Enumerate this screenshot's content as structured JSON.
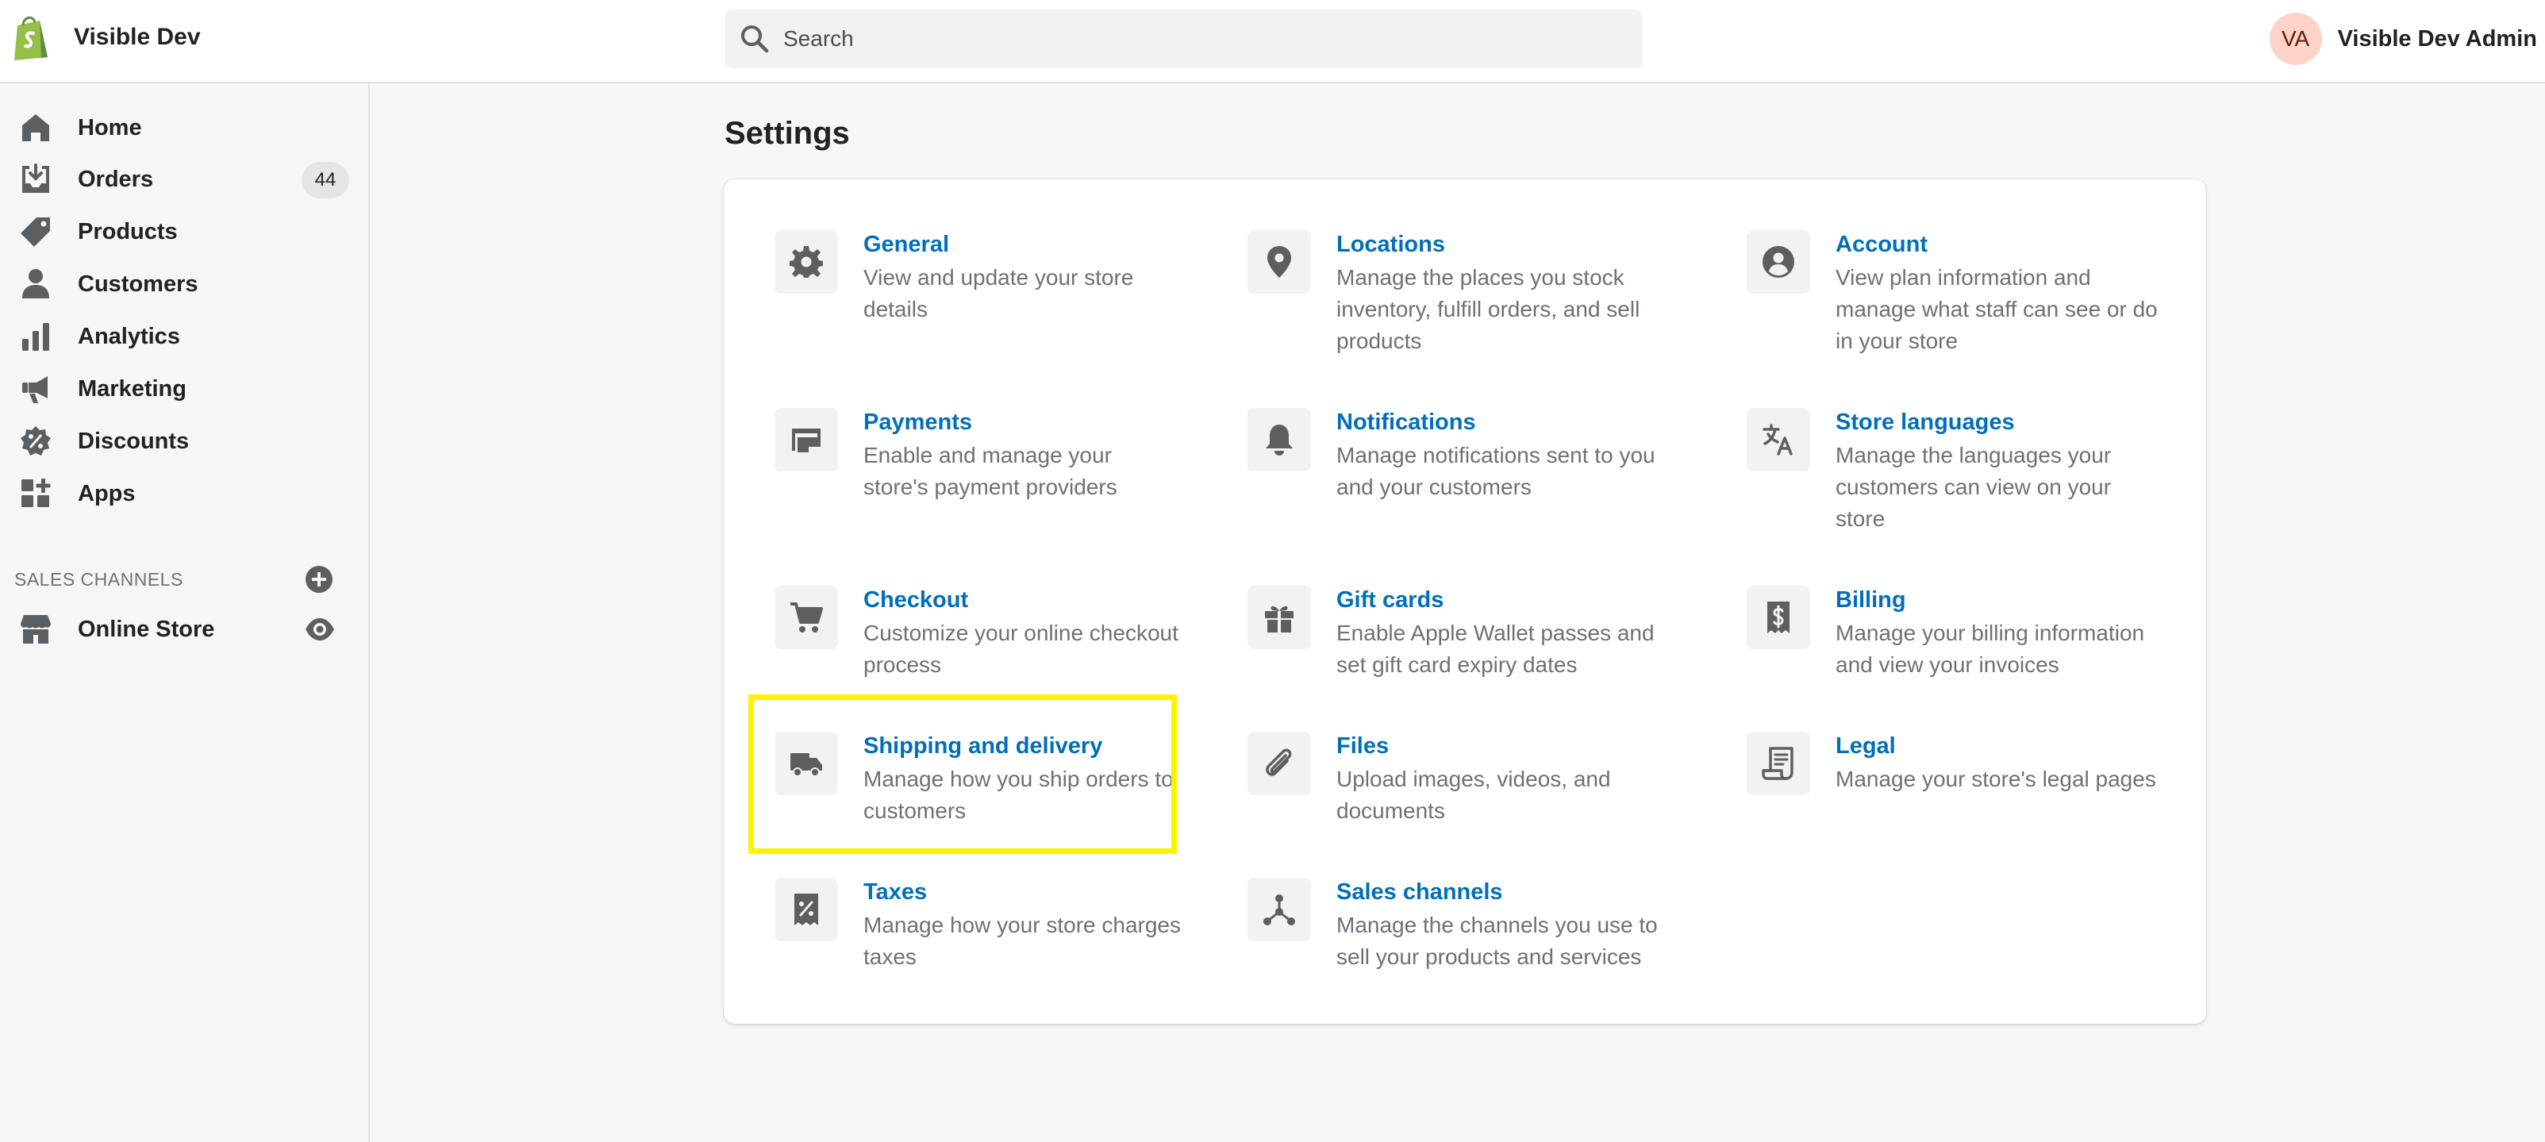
{
  "header": {
    "store_name": "Visible Dev",
    "search_placeholder": "Search",
    "user_initials": "VA",
    "user_name": "Visible Dev Admin"
  },
  "sidebar": {
    "items": [
      {
        "label": "Home",
        "icon": "home-icon"
      },
      {
        "label": "Orders",
        "icon": "orders-icon",
        "badge": "44"
      },
      {
        "label": "Products",
        "icon": "tag-icon"
      },
      {
        "label": "Customers",
        "icon": "person-icon"
      },
      {
        "label": "Analytics",
        "icon": "bar-chart-icon"
      },
      {
        "label": "Marketing",
        "icon": "megaphone-icon"
      },
      {
        "label": "Discounts",
        "icon": "discount-icon"
      },
      {
        "label": "Apps",
        "icon": "apps-icon"
      }
    ],
    "channels_heading": "SALES CHANNELS",
    "channels": [
      {
        "label": "Online Store",
        "icon": "store-icon"
      }
    ]
  },
  "main": {
    "title": "Settings",
    "settings": [
      {
        "title": "General",
        "desc": "View and update your store details",
        "icon": "gear-icon"
      },
      {
        "title": "Locations",
        "desc": "Manage the places you stock inventory, fulfill orders, and sell products",
        "icon": "location-pin-icon"
      },
      {
        "title": "Account",
        "desc": "View plan information and manage what staff can see or do in your store",
        "icon": "account-icon"
      },
      {
        "title": "Payments",
        "desc": "Enable and manage your store's payment providers",
        "icon": "payments-icon"
      },
      {
        "title": "Notifications",
        "desc": "Manage notifications sent to you and your customers",
        "icon": "bell-icon"
      },
      {
        "title": "Store languages",
        "desc": "Manage the languages your customers can view on your store",
        "icon": "translate-icon"
      },
      {
        "title": "Checkout",
        "desc": "Customize your online checkout process",
        "icon": "cart-icon"
      },
      {
        "title": "Gift cards",
        "desc": "Enable Apple Wallet passes and set gift card expiry dates",
        "icon": "gift-icon"
      },
      {
        "title": "Billing",
        "desc": "Manage your billing information and view your invoices",
        "icon": "billing-icon"
      },
      {
        "title": "Shipping and delivery",
        "desc": "Manage how you ship orders to customers",
        "icon": "truck-icon"
      },
      {
        "title": "Files",
        "desc": "Upload images, videos, and documents",
        "icon": "paperclip-icon"
      },
      {
        "title": "Legal",
        "desc": "Manage your store's legal pages",
        "icon": "legal-icon"
      },
      {
        "title": "Taxes",
        "desc": "Manage how your store charges taxes",
        "icon": "tax-icon"
      },
      {
        "title": "Sales channels",
        "desc": "Manage the channels you use to sell your products and services",
        "icon": "sales-channels-icon"
      }
    ]
  },
  "colors": {
    "link": "#006fbb",
    "highlight": "#fff200",
    "brand": "#95bf47"
  }
}
